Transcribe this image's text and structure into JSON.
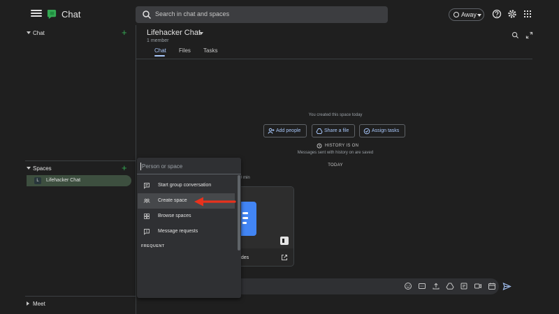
{
  "header": {
    "app_title": "Chat",
    "search_placeholder": "Search in chat and spaces",
    "status_label": "Away",
    "icons": [
      "menu-icon",
      "chat-logo-icon",
      "search-icon",
      "help-icon",
      "settings-icon",
      "apps-grid-icon"
    ]
  },
  "sidebar": {
    "chat_section": "Chat",
    "spaces_section": "Spaces",
    "meet_section": "Meet",
    "spaces": [
      {
        "avatar": "L",
        "label": "Lifehacker Chat"
      }
    ]
  },
  "room": {
    "title": "Lifehacker Chat",
    "members": "1 member",
    "tabs": [
      {
        "label": "Chat",
        "active": true
      },
      {
        "label": "Files",
        "active": false
      },
      {
        "label": "Tasks",
        "active": false
      }
    ],
    "created_text": "You created this space today",
    "actions": [
      "Add people",
      "Share a file",
      "Assign tasks"
    ],
    "history_title": "HISTORY IS ON",
    "history_sub": "Messages sent with history on are saved",
    "day_divider": "TODAY",
    "message_time": "0 min",
    "card_label": "odes"
  },
  "popup": {
    "placeholder": "Person or space",
    "items": [
      {
        "label": "Start group conversation",
        "icon": "chat-bubble-icon",
        "highlighted": false
      },
      {
        "label": "Create space",
        "icon": "people-icon",
        "highlighted": true
      },
      {
        "label": "Browse spaces",
        "icon": "browse-grid-icon",
        "highlighted": false
      },
      {
        "label": "Message requests",
        "icon": "message-request-icon",
        "highlighted": false
      }
    ],
    "section_label": "FREQUENT"
  },
  "colors": {
    "accent": "#a8c7fa",
    "brand_green": "#34a853",
    "arrow": "#e8321d",
    "active_space": "#3d4f3f"
  }
}
